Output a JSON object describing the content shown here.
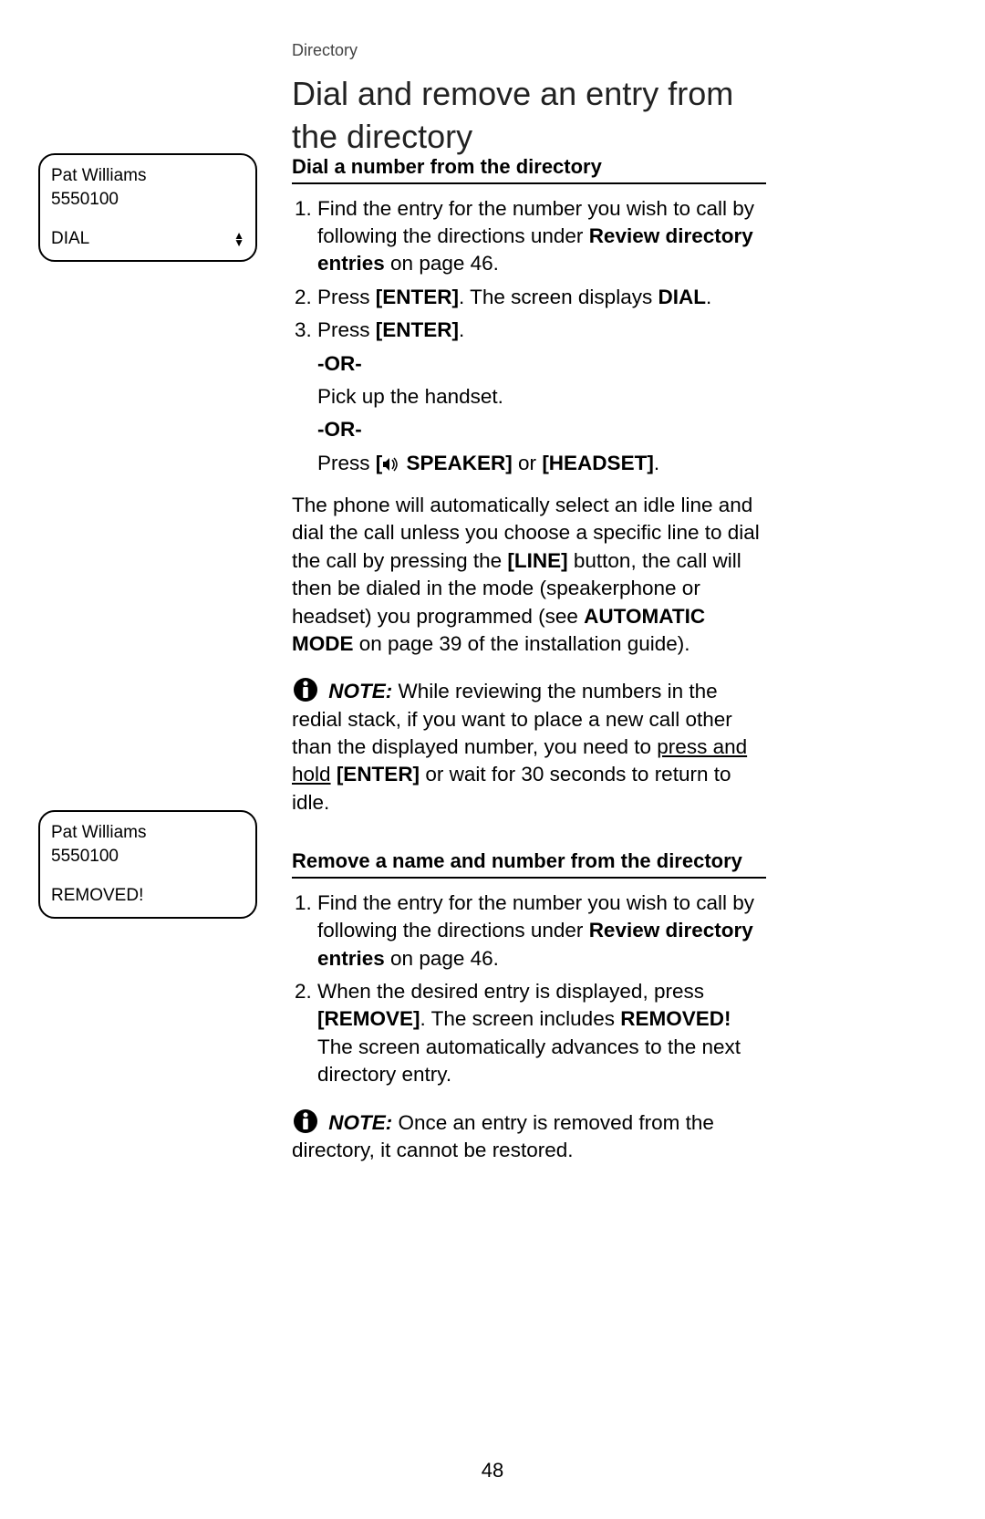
{
  "breadcrumb": "Directory",
  "title": "Dial and remove an entry from the directory",
  "page_number": "48",
  "sidebar": {
    "box1": {
      "name": "Pat Williams",
      "number": "5550100",
      "label": "DIAL"
    },
    "box2": {
      "name": "Pat Williams",
      "number": "5550100",
      "label": "REMOVED!"
    }
  },
  "section1": {
    "heading": "Dial a number from the directory",
    "step1_a": "Find the entry for the number you wish to call by following the directions under ",
    "step1_b": "Review directory entries",
    "step1_c": " on page 46.",
    "step2_a": "Press ",
    "step2_b": "[ENTER]",
    "step2_c": ". The screen displays ",
    "step2_d": "DIAL",
    "step2_e": ".",
    "step3_a": "Press ",
    "step3_b": "[ENTER]",
    "step3_c": ".",
    "or": "-OR-",
    "pick": "Pick up the handset.",
    "press_a": "Press ",
    "press_b": "[",
    "speaker": " SPEAKER]",
    "press_c": " or ",
    "headset": "[HEADSET]",
    "press_d": ".",
    "para_a": "The phone will automatically select an idle line and dial the call unless you choose a specific line to dial the call by pressing the ",
    "para_line": "[LINE]",
    "para_b": " button, the call will then be dialed in the mode (speakerphone or headset) you programmed (see ",
    "para_auto": "AUTOMATIC MODE",
    "para_c": " on page 39 of the installation guide).",
    "note_label": "NOTE:",
    "note_a": " While reviewing the numbers in the redial stack, if you want to place a new call other than the displayed number, you need to ",
    "note_under": "press and hold",
    "note_b": " ",
    "note_enter": "[ENTER]",
    "note_c": " or wait for 30 seconds to return to idle."
  },
  "section2": {
    "heading": "Remove a name and number from the directory",
    "step1_a": "Find the entry for the number you wish to call by following the directions under ",
    "step1_b": "Review directory entries",
    "step1_c": " on page 46.",
    "step2_a": "When the desired entry is displayed, press ",
    "step2_b": "[REMOVE]",
    "step2_c": ". The screen includes ",
    "step2_d": "REMOVED!",
    "step2_e": " The screen automatically advances to the next directory entry.",
    "note_label": "NOTE:",
    "note_a": " Once an entry is removed from the direc­tory, it cannot be restored."
  }
}
